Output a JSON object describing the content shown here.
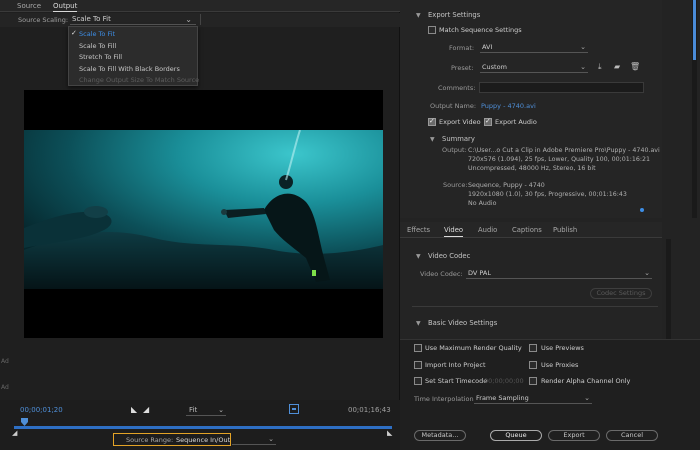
{
  "left_tabs": [
    "Source",
    "Output"
  ],
  "source_scaling": {
    "label": "Source Scaling:",
    "value": "Scale To Fit",
    "menu": [
      "Scale To Fit",
      "Scale To Fill",
      "Stretch To Fill",
      "Scale To Fill With Black Borders",
      "Change Output Size To Match Source"
    ]
  },
  "side_glyphs": [
    "Ad",
    "Ad"
  ],
  "playback": {
    "timecode_current": "00;00;01;20",
    "timecode_end": "00;01;16;43",
    "zoom": "Fit"
  },
  "source_range": {
    "label": "Source Range:",
    "value": "Sequence In/Out"
  },
  "export_settings": {
    "title": "Export Settings",
    "match_sequence": "Match Sequence Settings",
    "format_label": "Format:",
    "format_value": "AVI",
    "preset_label": "Preset:",
    "preset_value": "Custom",
    "comments_label": "Comments:",
    "output_name_label": "Output Name:",
    "output_name_value": "Puppy - 4740.avi",
    "export_video": "Export Video",
    "export_audio": "Export Audio"
  },
  "summary": {
    "title": "Summary",
    "output_label": "Output:",
    "output_lines": [
      "C:\\User...o Cut a Clip in Adobe Premiere Pro\\Puppy - 4740.avi",
      "720x576 (1.094), 25 fps, Lower, Quality 100, 00;01:16:21",
      "Uncompressed, 48000 Hz, Stereo, 16 bit"
    ],
    "source_label": "Source:",
    "source_lines": [
      "Sequence, Puppy - 4740",
      "1920x1080 (1.0), 30 fps, Progressive, 00;01:16:43",
      "No Audio"
    ]
  },
  "settings_tabs": [
    "Effects",
    "Video",
    "Audio",
    "Captions",
    "Publish"
  ],
  "video_codec": {
    "title": "Video Codec",
    "codec_label": "Video Codec:",
    "codec_value": "DV PAL",
    "codec_settings_button": "Codec Settings",
    "basic_title": "Basic Video Settings"
  },
  "render_options": {
    "use_max_quality": "Use Maximum Render Quality",
    "use_previews": "Use Previews",
    "import_into_project": "Import Into Project",
    "use_proxies": "Use Proxies",
    "set_start_timecode": "Set Start Timecode",
    "start_timecode_value": "00;00;00;00",
    "render_alpha": "Render Alpha Channel Only",
    "time_interp_label": "Time Interpolation",
    "time_interp_value": "Frame Sampling"
  },
  "buttons": {
    "metadata": "Metadata...",
    "queue": "Queue",
    "export": "Export",
    "cancel": "Cancel"
  },
  "colors": {
    "accent_blue": "#3d8ee6",
    "highlight_box": "#e3a326"
  }
}
